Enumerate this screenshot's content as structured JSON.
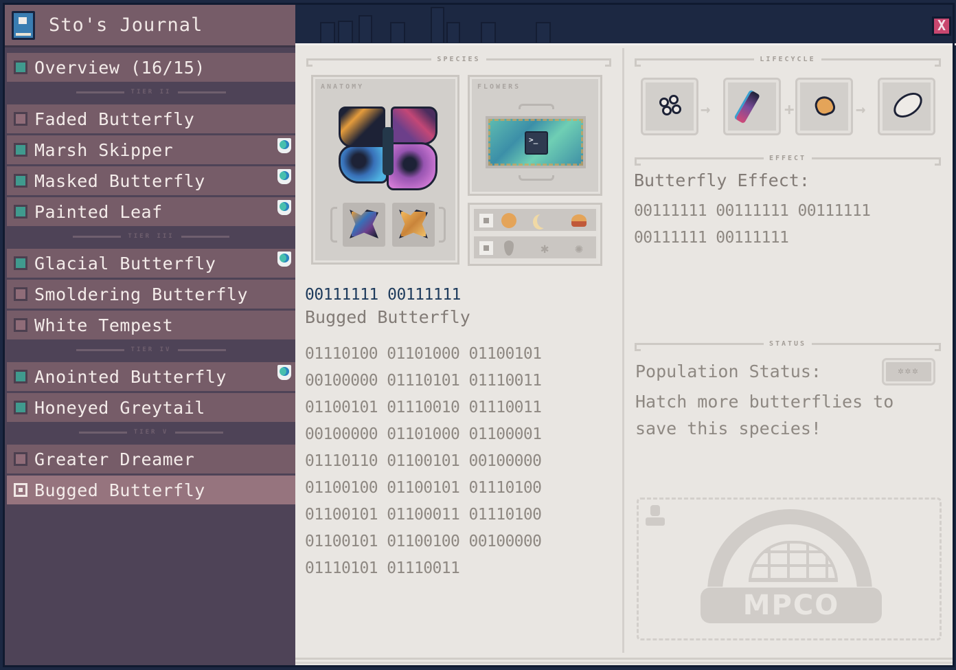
{
  "window": {
    "close_label": "X"
  },
  "sidebar": {
    "title": "Sto's Journal",
    "overview": {
      "label": "Overview (16/15)",
      "status": "discovered"
    },
    "tiers": [
      {
        "label": "Tier II",
        "items": [
          {
            "label": "Faded Butterfly",
            "status": "undiscovered",
            "badge": false
          },
          {
            "label": "Marsh Skipper",
            "status": "discovered",
            "badge": true
          },
          {
            "label": "Masked Butterfly",
            "status": "discovered",
            "badge": true
          },
          {
            "label": "Painted Leaf",
            "status": "discovered",
            "badge": true
          }
        ]
      },
      {
        "label": "Tier III",
        "items": [
          {
            "label": "Glacial Butterfly",
            "status": "discovered",
            "badge": true
          },
          {
            "label": "Smoldering Butterfly",
            "status": "undiscovered",
            "badge": false
          },
          {
            "label": "White Tempest",
            "status": "undiscovered",
            "badge": false
          }
        ]
      },
      {
        "label": "Tier IV",
        "items": [
          {
            "label": "Anointed Butterfly",
            "status": "discovered",
            "badge": true
          },
          {
            "label": "Honeyed Greytail",
            "status": "discovered",
            "badge": false
          }
        ]
      },
      {
        "label": "Tier V",
        "items": [
          {
            "label": "Greater Dreamer",
            "status": "undiscovered",
            "badge": false
          },
          {
            "label": "Bugged Butterfly",
            "status": "selected",
            "badge": false
          }
        ]
      }
    ]
  },
  "species": {
    "section_label": "Species",
    "anatomy_label": "Anatomy",
    "flowers_label": "Flowers",
    "flower_icon": "terminal-icon",
    "flower_icon_text": ">_",
    "conditions": [
      {
        "key_icon": "square-key-icon",
        "icons": [
          "orange-sun-icon",
          "crescent-moon-icon",
          "sunset-icon"
        ]
      },
      {
        "key_icon": "c-key-icon",
        "icons": [
          "raindrop-icon",
          "snowflake-icon",
          "sun-burst-icon"
        ]
      }
    ],
    "code": "00111111 00111111",
    "name": "Bugged Butterfly",
    "description": "01110100 01101000 01100101 00100000 01110101 01110011 01100101 01110010 01110011 00100000 01101000 01100001 01110110 01100101 00100000 01100100 01100101 01110100 01100101 01100011 01110100 01100101 01100100 00100000 01110101 01110011"
  },
  "lifecycle": {
    "section_label": "Lifecycle",
    "stages": [
      "eggs-icon",
      "caterpillar-icon",
      "seed-icon",
      "cocoon-icon"
    ],
    "connectors": [
      "→",
      "+",
      "→"
    ]
  },
  "effect": {
    "section_label": "Effect",
    "title": "Butterfly Effect:",
    "text": "00111111 00111111 00111111 00111111 00111111"
  },
  "status": {
    "section_label": "Status",
    "population_label": "Population Status:",
    "population_badge": "✲✲✲",
    "message": "Hatch more butterflies to save this species!",
    "stamp_text": "MPCO"
  },
  "colors": {
    "discovered": "#409a8e",
    "undiscovered": "#8f6c78",
    "sidebar_bg": "#4e4357",
    "item_bg": "#765c68",
    "selected_bg": "#96747e",
    "content_bg": "#e9e6e2",
    "close": "#c8476f",
    "code_title": "#1e3b5c"
  }
}
